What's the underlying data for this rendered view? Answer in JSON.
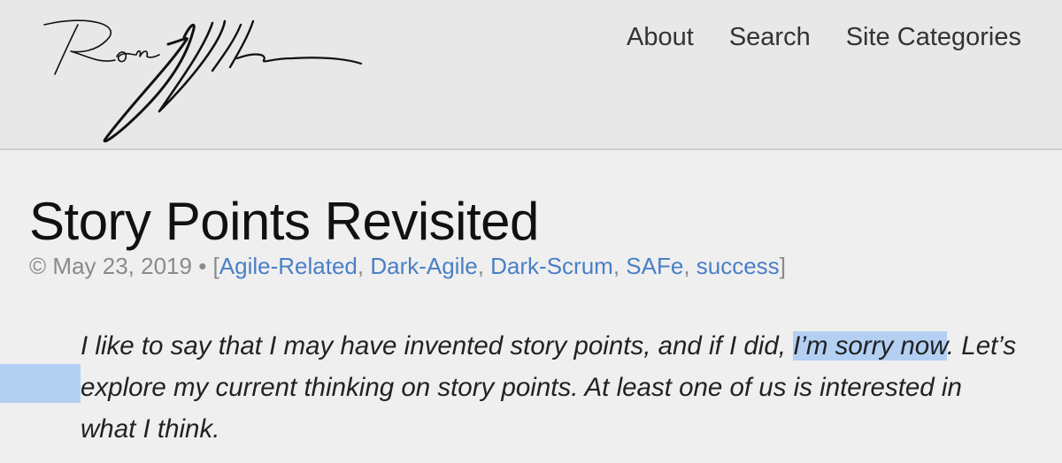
{
  "header": {
    "logo": {
      "text": "Ron Jeffries",
      "icon": "signature-logo"
    },
    "nav": [
      {
        "label": "About"
      },
      {
        "label": "Search"
      },
      {
        "label": "Site Categories"
      }
    ]
  },
  "post": {
    "title": "Story Points Revisited",
    "copyright_symbol": "©",
    "date": "May 23, 2019",
    "separator": "•",
    "categories_open": "[",
    "categories_close": "]",
    "categories": [
      "Agile-Related",
      "Dark-Agile",
      "Dark-Scrum",
      "SAFe",
      "success"
    ],
    "excerpt": {
      "before": "I like to say that I may have invented story points, and if I did, ",
      "highlighted": "I’m sorry now",
      "after": ". Let’s explore my current thinking on story points. At least one of us is interested in what I think."
    }
  },
  "colors": {
    "link": "#4a7fc5",
    "highlight": "#b3d0f3",
    "background": "#ececec"
  }
}
